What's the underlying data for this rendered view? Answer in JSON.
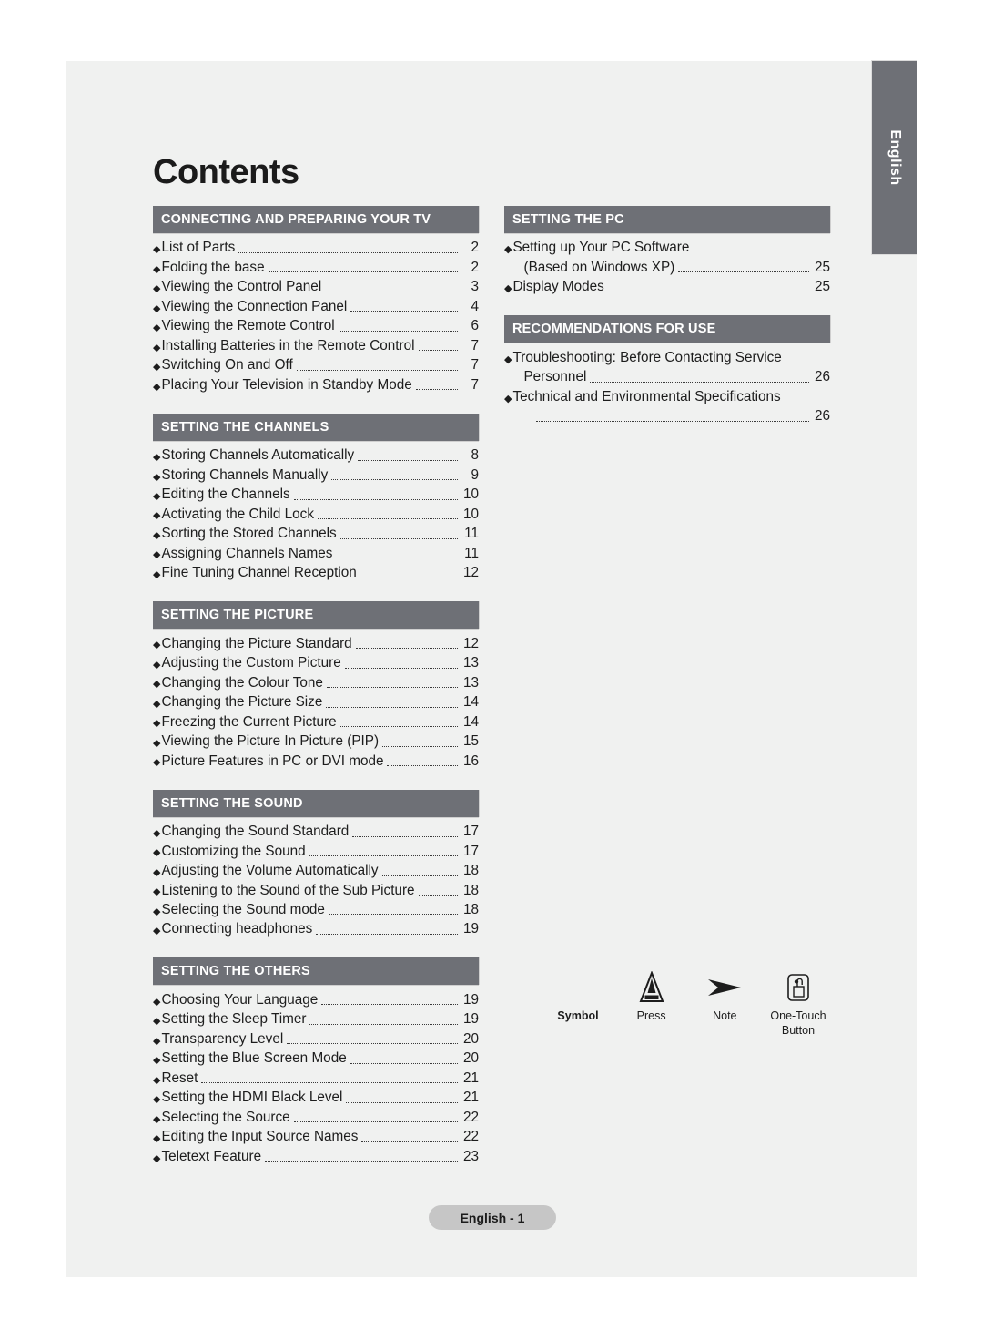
{
  "page": {
    "title": "Contents",
    "language_tab": "English",
    "footer_badge": "English - 1"
  },
  "columns": [
    {
      "sections": [
        {
          "header": "CONNECTING AND PREPARING YOUR TV",
          "entries": [
            {
              "text": "List of Parts",
              "page": "2"
            },
            {
              "text": "Folding the base",
              "page": "2"
            },
            {
              "text": "Viewing the Control Panel",
              "page": "3"
            },
            {
              "text": "Viewing the Connection Panel",
              "page": "4"
            },
            {
              "text": "Viewing the Remote Control",
              "page": "6"
            },
            {
              "text": "Installing Batteries in the Remote Control",
              "page": "7"
            },
            {
              "text": "Switching On and Off",
              "page": "7"
            },
            {
              "text": "Placing Your Television in Standby Mode",
              "page": "7"
            }
          ]
        },
        {
          "header": "SETTING THE CHANNELS",
          "entries": [
            {
              "text": "Storing Channels Automatically",
              "page": "8"
            },
            {
              "text": "Storing Channels Manually",
              "page": "9"
            },
            {
              "text": "Editing the Channels",
              "page": "10"
            },
            {
              "text": "Activating the Child Lock",
              "page": "10"
            },
            {
              "text": "Sorting the Stored Channels",
              "page": "11"
            },
            {
              "text": "Assigning Channels Names",
              "page": "11"
            },
            {
              "text": "Fine Tuning Channel Reception",
              "page": "12"
            }
          ]
        },
        {
          "header": "SETTING THE PICTURE",
          "entries": [
            {
              "text": "Changing the Picture Standard",
              "page": "12"
            },
            {
              "text": "Adjusting the Custom Picture",
              "page": "13"
            },
            {
              "text": "Changing the Colour Tone",
              "page": "13"
            },
            {
              "text": "Changing the Picture Size",
              "page": "14"
            },
            {
              "text": "Freezing the Current Picture",
              "page": "14"
            },
            {
              "text": "Viewing the Picture In Picture (PIP)",
              "page": "15"
            },
            {
              "text": "Picture Features in PC or DVI mode",
              "page": "16"
            }
          ]
        },
        {
          "header": "SETTING THE SOUND",
          "entries": [
            {
              "text": "Changing the Sound Standard",
              "page": "17"
            },
            {
              "text": "Customizing the Sound",
              "page": "17"
            },
            {
              "text": "Adjusting the Volume Automatically",
              "page": "18"
            },
            {
              "text": "Listening to the Sound of the Sub Picture",
              "page": "18"
            },
            {
              "text": "Selecting the Sound mode",
              "page": "18"
            },
            {
              "text": "Connecting headphones",
              "page": "19"
            }
          ]
        },
        {
          "header": "SETTING THE OTHERS",
          "entries": [
            {
              "text": "Choosing Your Language",
              "page": "19"
            },
            {
              "text": "Setting the Sleep Timer",
              "page": "19"
            },
            {
              "text": "Transparency Level",
              "page": "20"
            },
            {
              "text": "Setting the Blue Screen Mode",
              "page": "20"
            },
            {
              "text": "Reset",
              "page": "21"
            },
            {
              "text": "Setting the HDMI Black Level",
              "page": "21"
            },
            {
              "text": "Selecting the Source",
              "page": "22"
            },
            {
              "text": "Editing the Input Source Names",
              "page": "22"
            },
            {
              "text": "Teletext Feature",
              "page": "23"
            }
          ]
        }
      ]
    },
    {
      "sections": [
        {
          "header": "SETTING THE PC",
          "entries": [
            {
              "text": "Setting up Your PC Software",
              "page": ""
            },
            {
              "text": "(Based on Windows XP)",
              "page": "25",
              "continuation": true
            },
            {
              "text": "Display Modes",
              "page": "25"
            }
          ]
        },
        {
          "header": "RECOMMENDATIONS FOR USE",
          "entries": [
            {
              "text": "Troubleshooting: Before Contacting Service",
              "page": ""
            },
            {
              "text": "Personnel",
              "page": "26",
              "continuation": true
            },
            {
              "text": "Technical and Environmental Specifications",
              "page": ""
            },
            {
              "text": "",
              "page": "26",
              "continuation": true,
              "leader_only": true
            }
          ]
        }
      ]
    }
  ],
  "legend": {
    "items": [
      {
        "label": "Symbol",
        "icon": "symbol-label",
        "bold": true
      },
      {
        "label": "Press",
        "icon": "press-triangle-icon"
      },
      {
        "label": "Note",
        "icon": "note-arrow-icon"
      },
      {
        "label": "One-Touch\nButton",
        "icon": "one-touch-button-icon"
      }
    ]
  },
  "colors": {
    "header_bar": "#6e7076",
    "page_background": "#f0f1f0",
    "badge": "#c6c6c6",
    "text": "#1d1d1d"
  }
}
